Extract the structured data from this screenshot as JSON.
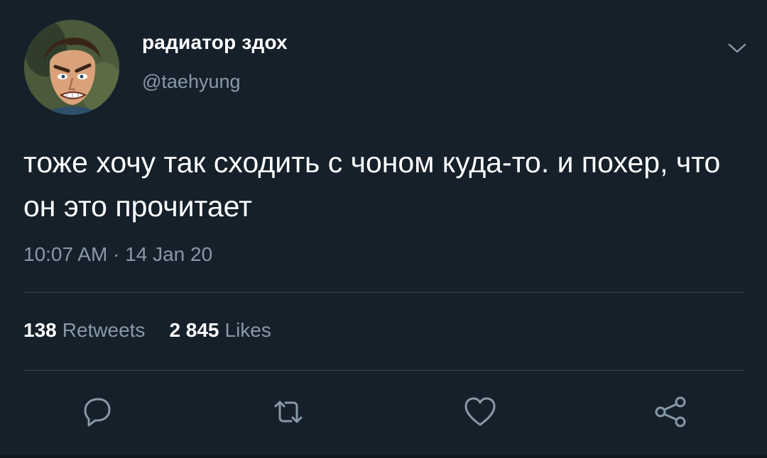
{
  "user": {
    "display_name": "радиатор здох",
    "handle": "@taehyung"
  },
  "tweet": {
    "text": "тоже хочу так сходить с чоном куда-то. и похер, что он это прочитает",
    "timestamp": "10:07 AM · 14 Jan 20"
  },
  "stats": {
    "retweets_count": "138",
    "retweets_label": "Retweets",
    "likes_count": "2 845",
    "likes_label": "Likes"
  },
  "icons": {
    "menu": "chevron-down-icon",
    "reply": "reply-icon",
    "retweet": "retweet-icon",
    "like": "heart-icon",
    "share": "share-icon"
  },
  "colors": {
    "background": "#15202b",
    "secondary_text": "#8899a6",
    "divider": "#38444d"
  }
}
